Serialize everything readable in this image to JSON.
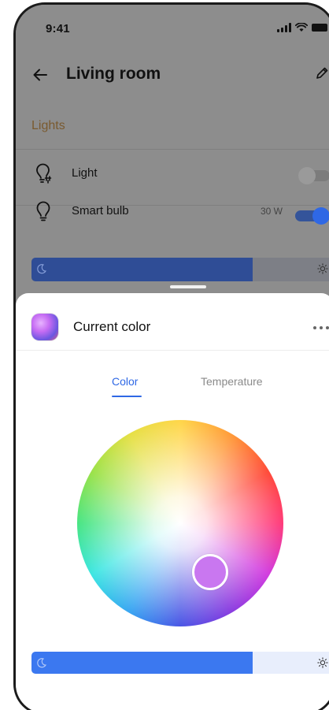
{
  "status_bar": {
    "time": "9:41"
  },
  "header": {
    "title": "Living room"
  },
  "section": {
    "title": "Lights"
  },
  "devices": [
    {
      "name": "Light",
      "power": "",
      "on": false
    },
    {
      "name": "Smart bulb",
      "power": "30 W",
      "on": true
    }
  ],
  "background_brightness": {
    "level": 0.73
  },
  "sheet": {
    "title": "Current color",
    "tabs": [
      {
        "label": "Color",
        "active": true
      },
      {
        "label": "Temperature",
        "active": false
      }
    ],
    "selected_color": "#c977f0",
    "brightness": {
      "level": 0.73
    }
  },
  "colors": {
    "accent": "#2f68e5",
    "section_title": "#7a5a2f",
    "toggle_on": "#2f68e5"
  },
  "icons": [
    "back-arrow-icon",
    "edit-pencil-icon",
    "smart-plug-bulb-icon",
    "bulb-icon",
    "moon-icon",
    "sun-icon",
    "more-icon"
  ]
}
